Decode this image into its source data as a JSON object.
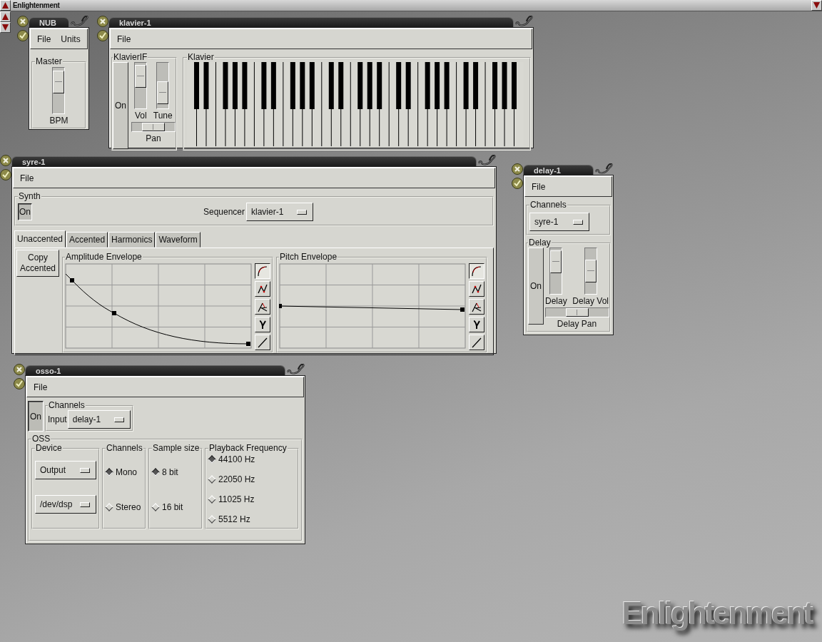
{
  "top_bar": {
    "title": "Enlightenment"
  },
  "nub": {
    "title": "NUB",
    "menu": [
      "File",
      "Units"
    ],
    "master": {
      "label": "Master",
      "slider": {
        "label": "BPM",
        "level": 0.85
      }
    }
  },
  "klavier": {
    "title": "klavier-1",
    "menu": [
      "File"
    ],
    "interface": {
      "label": "KlavierIF",
      "toggle": {
        "label": "On",
        "on": false
      },
      "sliders": [
        {
          "label": "Vol",
          "level": 0.9
        },
        {
          "label": "Tune",
          "level": 0.2
        }
      ],
      "pan": {
        "label": "Pan",
        "level": 0.5
      }
    },
    "keyboard": {
      "label": "Klavier"
    }
  },
  "syre": {
    "title": "syre-1",
    "menu": [
      "File"
    ],
    "synth": {
      "label": "Synth",
      "toggle": {
        "label": "On",
        "on": true
      },
      "sequencer": {
        "label": "Sequencer",
        "value": "klavier-1"
      }
    },
    "tabs": [
      {
        "label": "Unaccented",
        "selected": true
      },
      {
        "label": "Accented",
        "selected": false
      },
      {
        "label": "Harmonics",
        "selected": false
      },
      {
        "label": "Waveform",
        "selected": false
      }
    ],
    "copy_button": "Copy Accented",
    "envelopes": [
      {
        "label": "Amplitude Envelope",
        "kind": "amplitude",
        "modes": [
          {
            "kind": "curve",
            "selected": true
          },
          {
            "kind": "spline",
            "selected": false
          },
          {
            "kind": "lambda",
            "selected": false
          },
          {
            "kind": "gamma",
            "selected": false
          },
          {
            "kind": "linear",
            "selected": false
          }
        ]
      },
      {
        "label": "Pitch Envelope",
        "kind": "pitch",
        "modes": [
          {
            "kind": "curve",
            "selected": true
          },
          {
            "kind": "spline",
            "selected": false
          },
          {
            "kind": "lambda",
            "selected": false
          },
          {
            "kind": "gamma",
            "selected": false
          },
          {
            "kind": "linear",
            "selected": false
          }
        ]
      }
    ]
  },
  "delay": {
    "title": "delay-1",
    "menu": [
      "File"
    ],
    "channels": {
      "label": "Channels",
      "value": "syre-1"
    },
    "delay": {
      "label": "Delay",
      "toggle": {
        "label": "On",
        "on": false
      },
      "sliders": [
        {
          "label": "Delay",
          "level": 0.9
        },
        {
          "label": "Delay Vol",
          "level": 0.5
        }
      ],
      "pan": {
        "label": "Delay Pan",
        "level": 0.5
      }
    }
  },
  "osso": {
    "title": "osso-1",
    "menu": [
      "File"
    ],
    "toggle": {
      "label": "On",
      "on": true
    },
    "channels": {
      "label": "Channels",
      "input_label": "Input",
      "value": "delay-1"
    },
    "oss": {
      "label": "OSS",
      "device": {
        "label": "Device",
        "dropdowns": [
          "Output",
          "/dev/dsp"
        ]
      },
      "radio_groups": [
        {
          "label": "Channels",
          "options": [
            {
              "label": "Mono",
              "selected": true
            },
            {
              "label": "Stereo",
              "selected": false
            }
          ]
        },
        {
          "label": "Sample size",
          "options": [
            {
              "label": "8 bit",
              "selected": true
            },
            {
              "label": "16 bit",
              "selected": false
            }
          ]
        },
        {
          "label": "Playback Frequency",
          "options": [
            {
              "label": "44100 Hz",
              "selected": true
            },
            {
              "label": "22050 Hz",
              "selected": false
            },
            {
              "label": "11025 Hz",
              "selected": false
            },
            {
              "label": "5512 Hz",
              "selected": false
            }
          ]
        }
      ]
    }
  },
  "logo": {
    "text": "Enlightenment"
  }
}
